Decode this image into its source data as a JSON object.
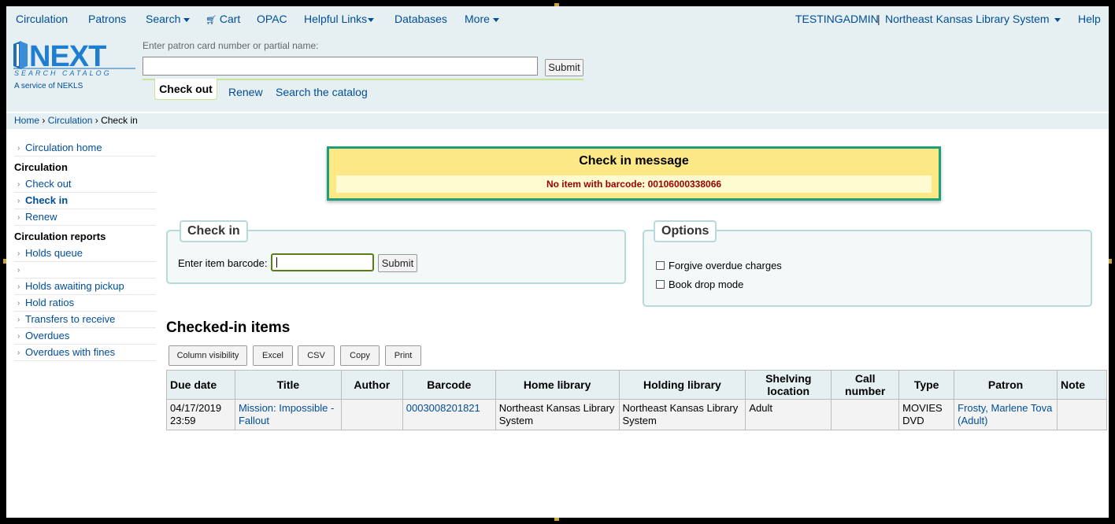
{
  "topnav": {
    "left": [
      "Circulation",
      "Patrons",
      "Search",
      "Cart",
      "OPAC",
      "Helpful Links",
      "Databases",
      "More"
    ],
    "user": "TESTINGADMIN",
    "library": "Northeast Kansas Library System",
    "help": "Help"
  },
  "header": {
    "logo_text": "NEXT",
    "logo_tagline": "SEARCH CATALOG",
    "logo_sub": "A service of NEKLS",
    "patron_label": "Enter patron card number or partial name:",
    "patron_value": "",
    "submit": "Submit",
    "tabs": {
      "checkout": "Check out",
      "renew": "Renew",
      "search_catalog": "Search the catalog"
    }
  },
  "breadcrumb": {
    "home": "Home",
    "sep": "›",
    "circulation": "Circulation",
    "current": "Check in"
  },
  "sidebar": {
    "circ_home": "Circulation home",
    "circ_head": "Circulation",
    "check_out": "Check out",
    "check_in": "Check in",
    "renew": "Renew",
    "reports_head": "Circulation reports",
    "holds_queue": "Holds queue",
    "blank": "",
    "holds_awaiting": "Holds awaiting pickup",
    "hold_ratios": "Hold ratios",
    "transfers": "Transfers to receive",
    "overdues": "Overdues",
    "overdues_fines": "Overdues with fines"
  },
  "message": {
    "title": "Check in message",
    "body": "No item with barcode: 00106000338066"
  },
  "checkin": {
    "legend": "Check in",
    "label": "Enter item barcode:",
    "value": "",
    "submit": "Submit"
  },
  "options": {
    "legend": "Options",
    "forgive": "Forgive overdue charges",
    "forgive_checked": false,
    "bookdrop": "Book drop mode",
    "bookdrop_checked": false
  },
  "checked_in": {
    "heading": "Checked-in items",
    "buttons": [
      "Column visibility",
      "Excel",
      "CSV",
      "Copy",
      "Print"
    ],
    "columns": [
      "Due date",
      "Title",
      "Author",
      "Barcode",
      "Home library",
      "Holding library",
      "Shelving location",
      "Call number",
      "Type",
      "Patron",
      "Note"
    ],
    "rows": [
      {
        "due_date": "04/17/2019 23:59",
        "title": "Mission: Impossible - Fallout",
        "author": "",
        "barcode": "0003008201821",
        "home_library": "Northeast Kansas Library System",
        "holding_library": "Northeast Kansas Library System",
        "shelving_location": "Adult",
        "call_number": "",
        "type": "MOVIES DVD",
        "patron": "Frosty, Marlene Tova (Adult)",
        "note": ""
      }
    ]
  },
  "colors": {
    "link": "#004d99",
    "header_bg": "#e6f0f2",
    "message_border": "#1e9e7a",
    "message_bg": "#fce985",
    "error_text": "#990000"
  }
}
